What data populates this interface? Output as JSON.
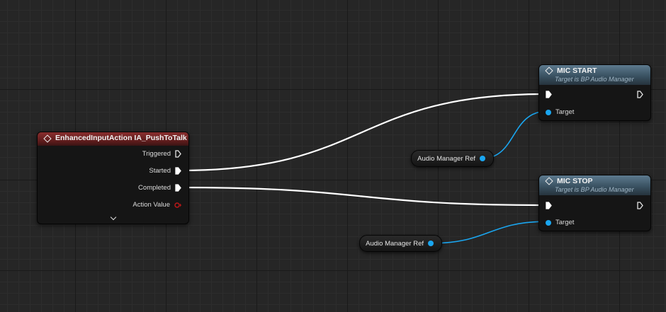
{
  "colors": {
    "exec_wire": "#ffffff",
    "object_pin": "#1aa6f0",
    "action_value_pin": "#c01818",
    "event_header": "#8a2e2e",
    "function_header": "#3a5262"
  },
  "event_node": {
    "title": "EnhancedInputAction IA_PushToTalk",
    "pins": [
      {
        "label": "Triggered",
        "kind": "exec",
        "connected": false
      },
      {
        "label": "Started",
        "kind": "exec",
        "connected": true
      },
      {
        "label": "Completed",
        "kind": "exec",
        "connected": true
      },
      {
        "label": "Action Value",
        "kind": "value",
        "connected": false
      }
    ],
    "expand_icon": "chevron-down-icon"
  },
  "mic_start": {
    "title": "MIC START",
    "subtitle": "Target is BP Audio Manager",
    "target_label": "Target"
  },
  "mic_stop": {
    "title": "MIC STOP",
    "subtitle": "Target is BP Audio Manager",
    "target_label": "Target"
  },
  "ref_1": {
    "label": "Audio Manager Ref"
  },
  "ref_2": {
    "label": "Audio Manager Ref"
  }
}
